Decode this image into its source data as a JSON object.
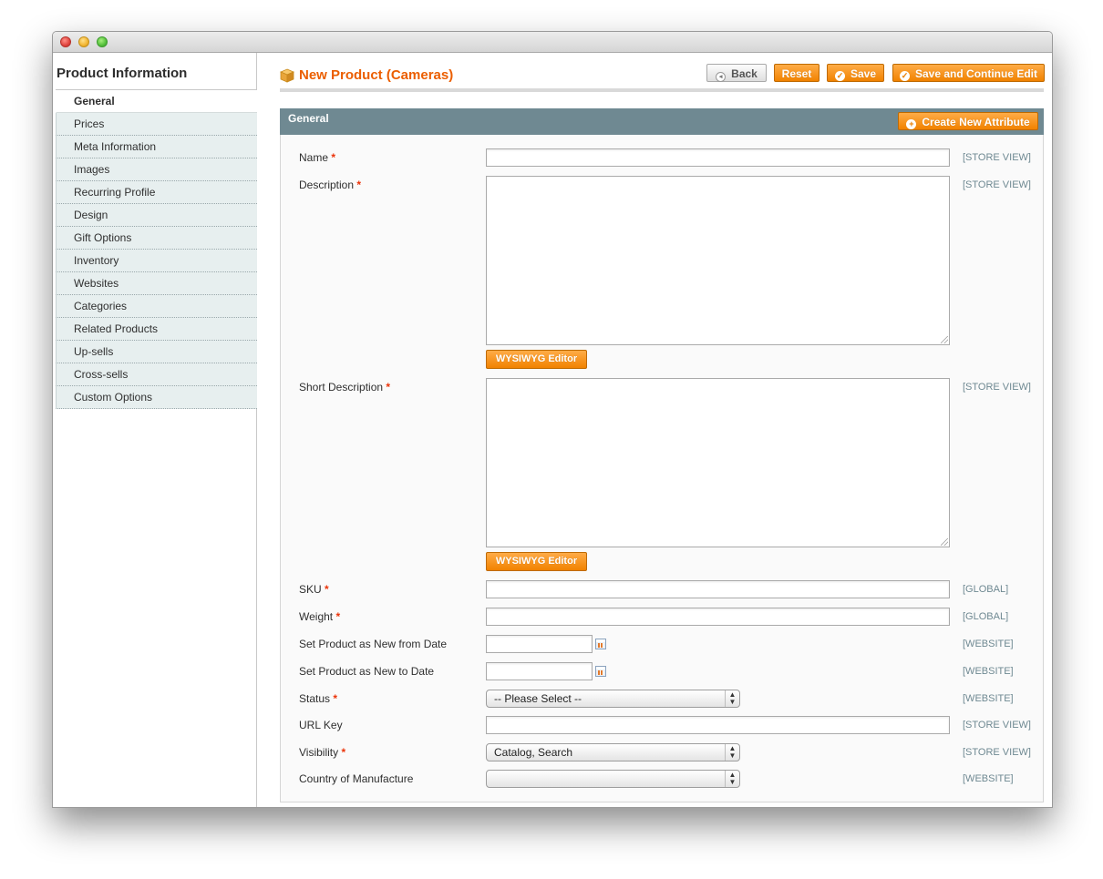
{
  "sidebar": {
    "title": "Product Information",
    "items": [
      {
        "label": "General"
      },
      {
        "label": "Prices"
      },
      {
        "label": "Meta Information"
      },
      {
        "label": "Images"
      },
      {
        "label": "Recurring Profile"
      },
      {
        "label": "Design"
      },
      {
        "label": "Gift Options"
      },
      {
        "label": "Inventory"
      },
      {
        "label": "Websites"
      },
      {
        "label": "Categories"
      },
      {
        "label": "Related Products"
      },
      {
        "label": "Up-sells"
      },
      {
        "label": "Cross-sells"
      },
      {
        "label": "Custom Options"
      }
    ]
  },
  "header": {
    "title": "New Product (Cameras)",
    "back_label": "Back",
    "reset_label": "Reset",
    "save_label": "Save",
    "save_continue_label": "Save and Continue Edit"
  },
  "fieldset": {
    "legend": "General",
    "create_attribute_label": "Create New Attribute",
    "wysiwyg_label": "WYSIWYG Editor",
    "required_mark": "*"
  },
  "fields": {
    "name": {
      "label": "Name",
      "scope": "[STORE VIEW]",
      "value": ""
    },
    "description": {
      "label": "Description",
      "scope": "[STORE VIEW]",
      "value": ""
    },
    "short_description": {
      "label": "Short Description",
      "scope": "[STORE VIEW]",
      "value": ""
    },
    "sku": {
      "label": "SKU",
      "scope": "[GLOBAL]",
      "value": ""
    },
    "weight": {
      "label": "Weight",
      "scope": "[GLOBAL]",
      "value": ""
    },
    "new_from": {
      "label": "Set Product as New from Date",
      "scope": "[WEBSITE]",
      "value": ""
    },
    "new_to": {
      "label": "Set Product as New to Date",
      "scope": "[WEBSITE]",
      "value": ""
    },
    "status": {
      "label": "Status",
      "scope": "[WEBSITE]",
      "value": "-- Please Select --"
    },
    "url_key": {
      "label": "URL Key",
      "scope": "[STORE VIEW]",
      "value": ""
    },
    "visibility": {
      "label": "Visibility",
      "scope": "[STORE VIEW]",
      "value": "Catalog, Search"
    },
    "country": {
      "label": "Country of Manufacture",
      "scope": "[WEBSITE]",
      "value": ""
    }
  },
  "colors": {
    "accent": "#eb5e00",
    "button": "#f18200",
    "fieldset_header": "#6f8992",
    "required": "#eb340a"
  },
  "icons": [
    "box-icon",
    "back-arrow-icon",
    "checkmark-icon",
    "plus-icon",
    "calendar-icon",
    "select-arrows-icon"
  ]
}
